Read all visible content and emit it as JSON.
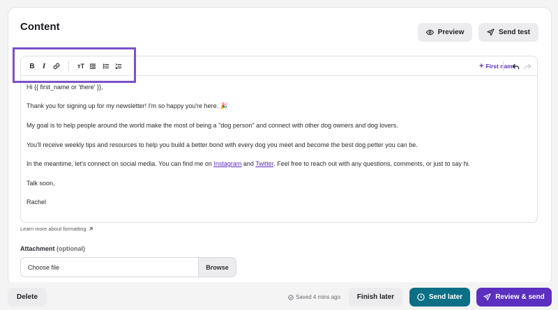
{
  "section": {
    "title": "Content"
  },
  "header_actions": {
    "preview_label": "Preview",
    "send_test_label": "Send test"
  },
  "toolbar": {
    "bold": "B",
    "italic": "I",
    "text_size": "тT",
    "first_name_label": "First name",
    "icons": [
      "bold-icon",
      "italic-icon",
      "link-icon",
      "text-size-icon",
      "indent-list-icon",
      "bullet-list-icon",
      "numbered-list-icon",
      "plus-icon",
      "undo-icon",
      "redo-icon"
    ]
  },
  "editor": {
    "greeting": "Hi {{ first_name or 'there' }},",
    "para1": "Thank you for signing up for my newsletter! I'm so happy you're here. 🎉",
    "para2": "My goal is to help people around the world make the most of being a \"dog person\" and connect with other dog owners and dog lovers.",
    "para3": "You'll receive weekly tips and resources to help you build a better bond with every dog you meet and become the best dog petter you can be.",
    "para4_pre": "In the meantime, let's connect on social media. You can find me on ",
    "link_instagram": "Instagram",
    "para4_mid": " and ",
    "link_twitter": "Twitter",
    "para4_post": ". Feel free to reach out with any questions, comments, or just to say hi.",
    "signoff": "Talk soon,",
    "signature": "Rachel"
  },
  "learn_more": "Learn more about formatting",
  "attachment": {
    "label": "Attachment",
    "optional": "(optional)",
    "placeholder": "Choose file",
    "browse_label": "Browse"
  },
  "footer": {
    "delete_label": "Delete",
    "saved_status": "Saved 4 mins ago",
    "finish_later_label": "Finish later",
    "send_later_label": "Send later",
    "review_send_label": "Review & send"
  },
  "colors": {
    "accent": "#5b2fc0",
    "teal": "#0b6f86",
    "highlight_box": "#7a52c8"
  }
}
